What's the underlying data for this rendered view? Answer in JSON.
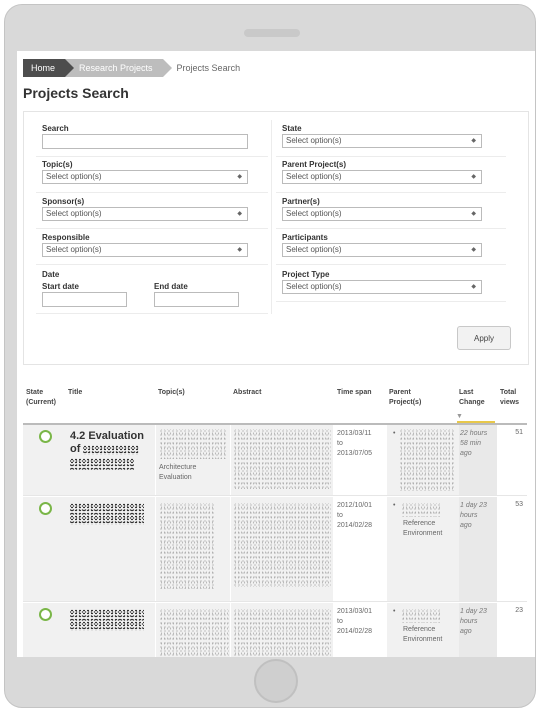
{
  "breadcrumb": {
    "home": "Home",
    "research_projects": "Research Projects",
    "current": "Projects Search"
  },
  "page_title": "Projects Search",
  "filters": {
    "search": {
      "label": "Search",
      "value": ""
    },
    "state": {
      "label": "State",
      "placeholder": "Select option(s)"
    },
    "topics": {
      "label": "Topic(s)",
      "placeholder": "Select option(s)"
    },
    "parent_projects": {
      "label": "Parent Project(s)",
      "placeholder": "Select option(s)"
    },
    "sponsors": {
      "label": "Sponsor(s)",
      "placeholder": "Select option(s)"
    },
    "partners": {
      "label": "Partner(s)",
      "placeholder": "Select option(s)"
    },
    "responsible": {
      "label": "Responsible",
      "placeholder": "Select option(s)"
    },
    "participants": {
      "label": "Participants",
      "placeholder": "Select option(s)"
    },
    "date": {
      "label": "Date",
      "start_label": "Start date",
      "end_label": "End date",
      "start_value": "",
      "end_value": ""
    },
    "project_type": {
      "label": "Project Type",
      "placeholder": "Select option(s)"
    },
    "apply_label": "Apply"
  },
  "table": {
    "headers": {
      "state": [
        "State",
        "(Current)"
      ],
      "title": "Title",
      "topics": "Topic(s)",
      "abstract": "Abstract",
      "time_span": "Time span",
      "parent": [
        "Parent",
        "Project(s)"
      ],
      "last_change": [
        "Last",
        "Change"
      ],
      "total_views": [
        "Total",
        "views"
      ]
    },
    "sort_indicator": "▼",
    "rows": [
      {
        "title_lines": [
          "4.2 Evaluation",
          "of"
        ],
        "topics": [
          "Architecture",
          "Evaluation"
        ],
        "time_start": "2013/03/11",
        "time_to": "to",
        "time_end": "2013/07/05",
        "parent_bullet": "•",
        "parent_text": [],
        "last_change": [
          "22 hours",
          "58 min",
          "ago"
        ],
        "views": "51"
      },
      {
        "title_lines": [],
        "topics": [],
        "time_start": "2012/10/01",
        "time_to": "to",
        "time_end": "2014/02/28",
        "parent_bullet": "•",
        "parent_text": [
          "Reference",
          "Environment"
        ],
        "last_change": [
          "1 day 23",
          "hours",
          "ago"
        ],
        "views": "53"
      },
      {
        "title_lines": [],
        "topics": [],
        "time_start": "2013/03/01",
        "time_to": "to",
        "time_end": "2014/02/28",
        "parent_bullet": "•",
        "parent_text": [
          "Reference",
          "Environment"
        ],
        "last_change": [
          "1 day 23",
          "hours",
          "ago"
        ],
        "views": "23"
      }
    ]
  },
  "colors": {
    "state_active": "#7ab648",
    "sort_accent": "#e8c84a",
    "breadcrumb_home": "#4d4d4d"
  }
}
